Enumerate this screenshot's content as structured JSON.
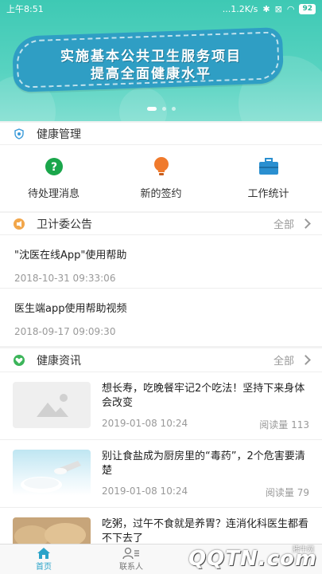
{
  "status_bar": {
    "time": "上午8:51",
    "network_speed": "...1.2K/s",
    "battery": "92"
  },
  "banner": {
    "line1": "实施基本公共卫生服务项目",
    "line2": "提高全面健康水平",
    "active_slide": 1,
    "slide_count": 3
  },
  "health_management": {
    "title": "健康管理",
    "items": [
      {
        "label": "待处理消息",
        "icon": "question-circle-icon",
        "color": "#1aa64b"
      },
      {
        "label": "新的签约",
        "icon": "lightbulb-icon",
        "color": "#f07a2c"
      },
      {
        "label": "工作统计",
        "icon": "briefcase-icon",
        "color": "#2a8fd0"
      }
    ]
  },
  "announcements": {
    "title": "卫计委公告",
    "more_label": "全部",
    "items": [
      {
        "title": "\"沈医在线App\"使用帮助",
        "time": "2018-10-31 09:33:06"
      },
      {
        "title": "医生端app使用帮助视频",
        "time": "2018-09-17 09:09:30"
      }
    ]
  },
  "health_news": {
    "title": "健康资讯",
    "more_label": "全部",
    "items": [
      {
        "title": "想长寿，吃晚餐牢记2个吃法！坚持下来身体会改变",
        "date": "2019-01-08 10:24",
        "reads": "阅读量 113"
      },
      {
        "title": "别让食盐成为厨房里的“毒药”，2个危害要清楚",
        "date": "2019-01-08 10:24",
        "reads": "阅读量 79"
      },
      {
        "title": "吃粥，过午不食就是养胃？连消化科医生都看不下去了",
        "date": "",
        "reads": ""
      }
    ]
  },
  "tab_bar": {
    "tabs": [
      {
        "label": "首页",
        "active": true
      },
      {
        "label": "联系人",
        "active": false
      }
    ]
  },
  "watermark": {
    "logo": "QQTN.com",
    "caption": "腾牛网"
  },
  "colors": {
    "accent": "#2aa3c9",
    "banner_bg": "#3ec9b4"
  }
}
